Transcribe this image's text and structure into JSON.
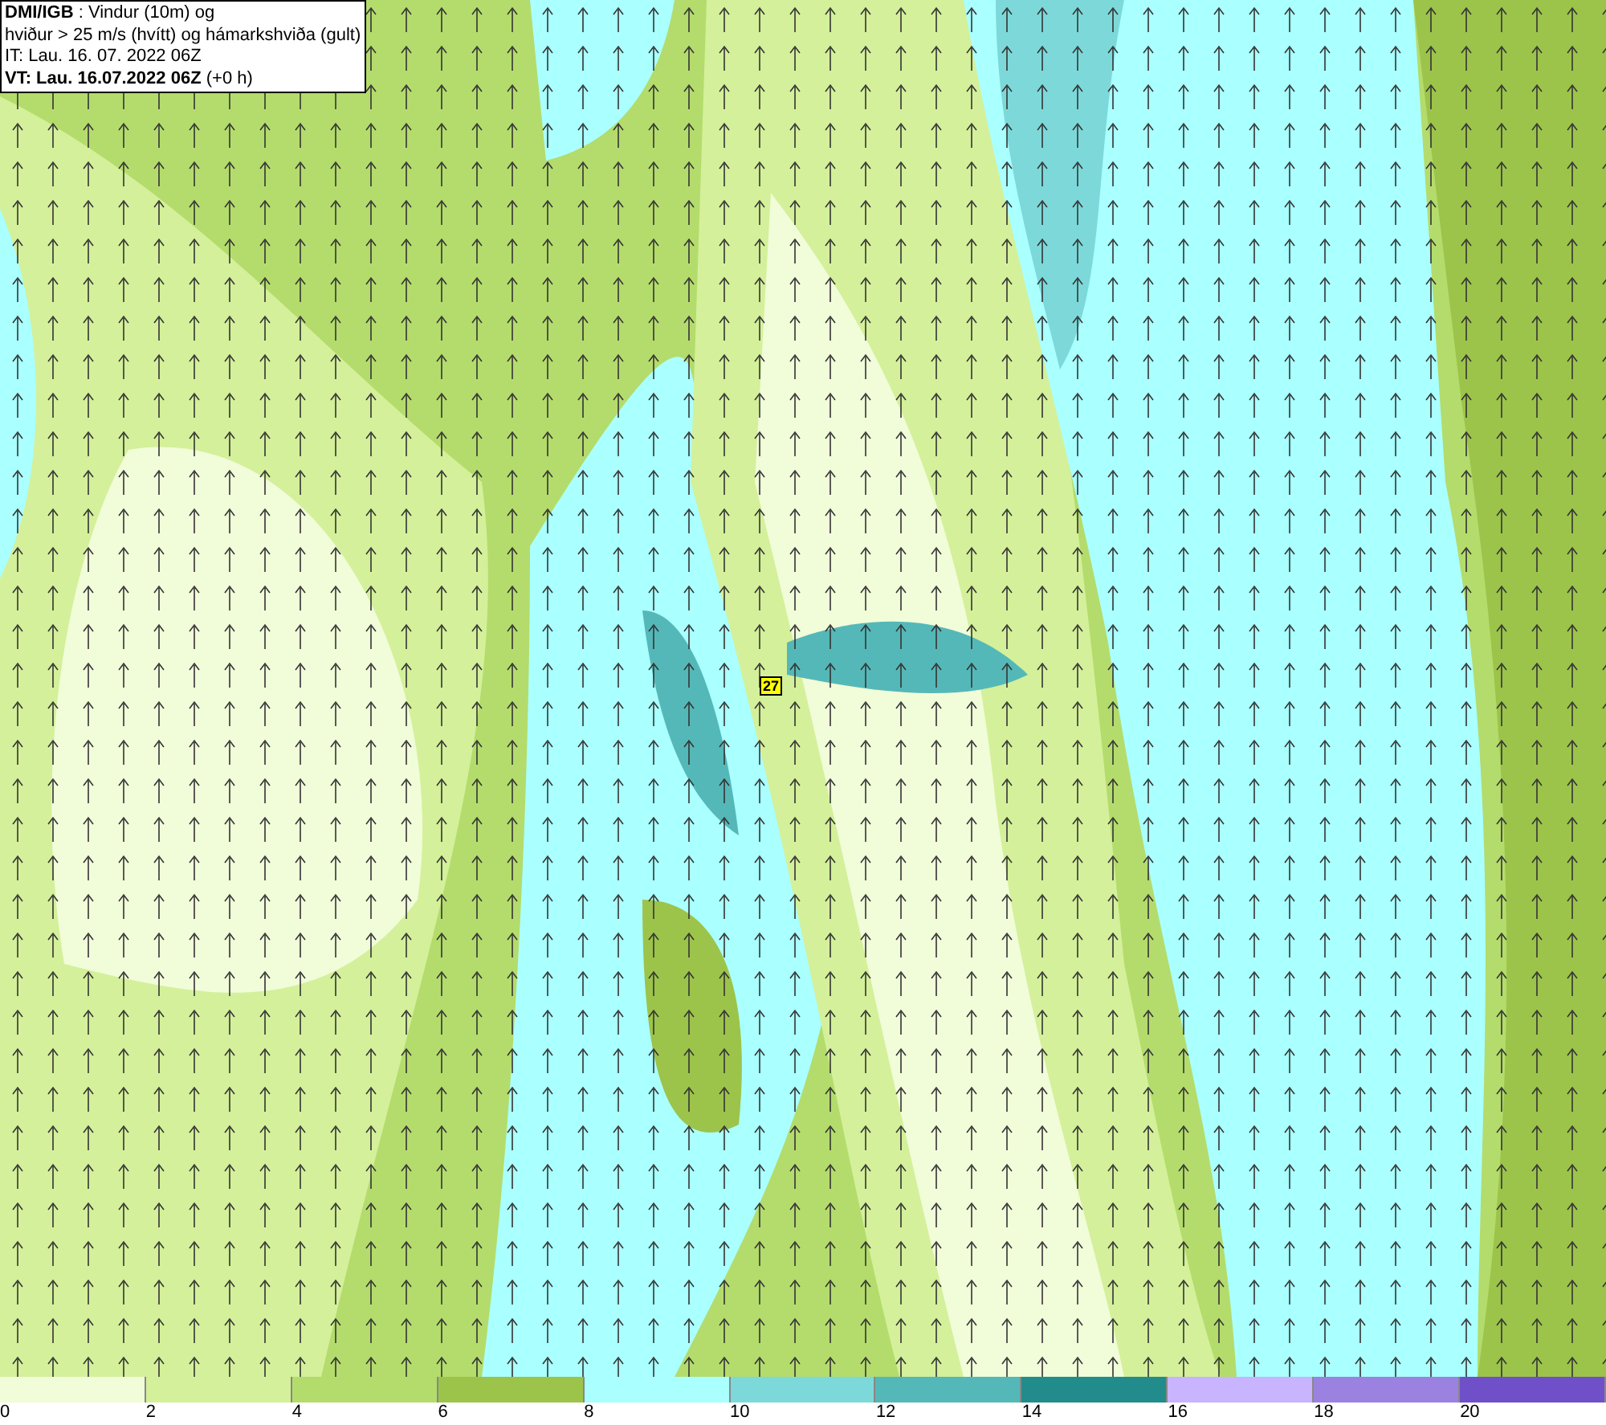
{
  "title_box": {
    "lines": [
      "**DMI/IGB** : Vindur (10m) og",
      "hviður > 25 m/s (hvítt) og hámarkshviða (gult)",
      "IT: Lau. 16. 07. 2022 06Z",
      "**VT: Lau. 16.07.2022 06Z** (+0 h)"
    ]
  },
  "map": {
    "gust_labels": [
      {
        "value": "27"
      }
    ]
  },
  "legend": [
    {
      "label": "0",
      "color": "#f1fcd9"
    },
    {
      "label": "2",
      "color": "#d4f09a"
    },
    {
      "label": "4",
      "color": "#b4dc6c"
    },
    {
      "label": "6",
      "color": "#9cc44a"
    },
    {
      "label": "8",
      "color": "#aaffff"
    },
    {
      "label": "10",
      "color": "#7dd9d9"
    },
    {
      "label": "12",
      "color": "#55b8b8"
    },
    {
      "label": "14",
      "color": "#228c8c"
    },
    {
      "label": "16",
      "color": "#c8b4ff"
    },
    {
      "label": "18",
      "color": "#9c82e0"
    },
    {
      "label": "20",
      "color": "#7050c8"
    }
  ]
}
